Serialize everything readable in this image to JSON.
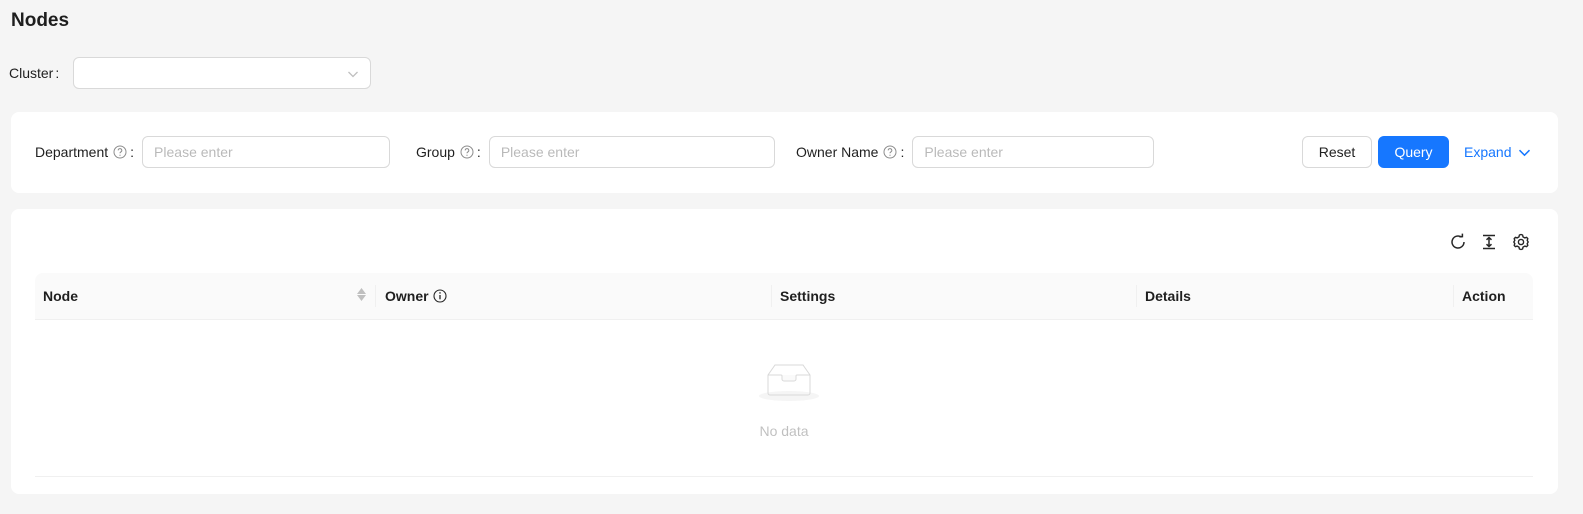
{
  "page": {
    "title": "Nodes"
  },
  "cluster": {
    "label": "Cluster",
    "colon": ":",
    "value": ""
  },
  "filters": {
    "department": {
      "label": "Department",
      "placeholder": "Please enter"
    },
    "group": {
      "label": "Group",
      "placeholder": "Please enter"
    },
    "owner_name": {
      "label": "Owner Name",
      "placeholder": "Please enter"
    },
    "colon": ":"
  },
  "actions": {
    "reset_label": "Reset",
    "query_label": "Query",
    "expand_label": "Expand"
  },
  "toolbar": {
    "icons": [
      "reload-icon",
      "column-height-icon",
      "setting-icon"
    ]
  },
  "table": {
    "columns": [
      {
        "label": "Node",
        "sortable": true
      },
      {
        "label": "Owner",
        "info_icon": true
      },
      {
        "label": "Settings"
      },
      {
        "label": "Details"
      },
      {
        "label": "Action"
      }
    ],
    "rows": [],
    "empty_text": "No data"
  },
  "colors": {
    "primary": "#1677ff",
    "background": "#f5f5f5"
  }
}
